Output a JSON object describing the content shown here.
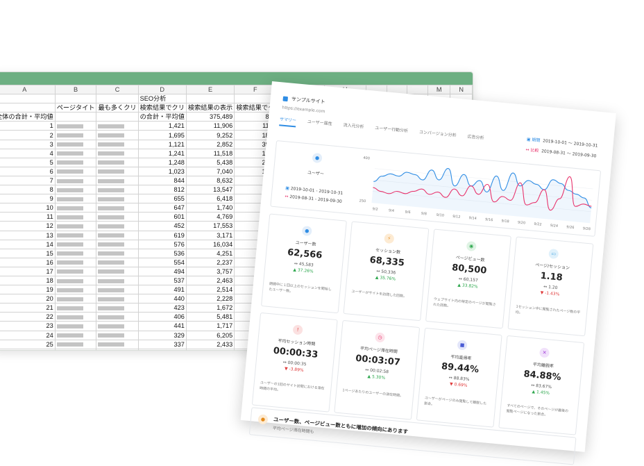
{
  "spreadsheet": {
    "columns": [
      "A",
      "B",
      "C",
      "D",
      "E",
      "F",
      "G",
      "H",
      "",
      "",
      "",
      "M",
      "N"
    ],
    "group_row": [
      "",
      "",
      "",
      "SEO分析",
      "",
      "",
      "",
      "サイト分析"
    ],
    "header_row": [
      "",
      "ページタイト",
      "最も多くクリ",
      "検索結果でクリ",
      "検索結果の表示",
      "検索結果でク",
      "検索結果の平均",
      "セッション数"
    ],
    "total_row": [
      "全体の合計・平均値",
      "",
      "",
      "の合計・平均値",
      "375,489",
      "8.1",
      "15.1",
      "48,947"
    ],
    "rows": [
      [
        "1",
        "1,421",
        "11,906",
        "11.9",
        "7.4",
        "2,489"
      ],
      [
        "2",
        "1,695",
        "9,252",
        "18.3",
        "7.8",
        "2,335"
      ],
      [
        "3",
        "1,121",
        "2,852",
        "39.3",
        "11.7",
        "1,996"
      ],
      [
        "4",
        "1,241",
        "11,518",
        "10.8",
        "5.7",
        "1,947"
      ],
      [
        "5",
        "1,248",
        "5,438",
        "22.9",
        "7.5",
        "1,858"
      ],
      [
        "6",
        "1,023",
        "7,040",
        "14.3",
        "9",
        "1,66"
      ],
      [
        "7",
        "844",
        "8,632",
        "9.8",
        "7.3",
        "1,32"
      ],
      [
        "8",
        "812",
        "13,547",
        "6",
        "7.1",
        "1,1"
      ],
      [
        "9",
        "655",
        "6,418",
        "10.2",
        "7.7",
        "1,0"
      ],
      [
        "10",
        "647",
        "1,740",
        "37.2",
        "9",
        "9"
      ],
      [
        "11",
        "601",
        "4,769",
        "12.6",
        "6",
        "9"
      ],
      [
        "12",
        "452",
        "17,553",
        "2.6",
        "8",
        "8"
      ],
      [
        "13",
        "619",
        "3,171",
        "19.5",
        "31.3",
        "8"
      ],
      [
        "14",
        "576",
        "16,034",
        "3.6",
        "7.8",
        ""
      ],
      [
        "15",
        "536",
        "4,251",
        "12.6",
        "6.5",
        ""
      ],
      [
        "16",
        "554",
        "2,237",
        "24.8",
        "5.2",
        ""
      ],
      [
        "17",
        "494",
        "3,757",
        "13.1",
        "17.6",
        ""
      ],
      [
        "18",
        "537",
        "2,463",
        "21.8",
        "7.5",
        ""
      ],
      [
        "19",
        "491",
        "2,514",
        "19.5",
        "4.5",
        ""
      ],
      [
        "20",
        "440",
        "2,228",
        "19.7",
        "4.4",
        ""
      ],
      [
        "21",
        "423",
        "1,672",
        "25.3",
        "11.5",
        ""
      ],
      [
        "22",
        "406",
        "5,481",
        "7.4",
        "11.6",
        ""
      ],
      [
        "23",
        "441",
        "1,717",
        "25.7",
        "20.9",
        ""
      ],
      [
        "24",
        "329",
        "6,205",
        "5.3",
        "11",
        ""
      ],
      [
        "25",
        "337",
        "2,433",
        "13.9",
        "25.2",
        ""
      ],
      [
        "26",
        "255",
        "8,591",
        "3",
        "9.8",
        ""
      ],
      [
        "27",
        "274",
        "4,258",
        "6.4",
        "7.3",
        ""
      ]
    ]
  },
  "dashboard": {
    "site_name": "サンプルサイト",
    "site_url": "https://example.com",
    "tabs": [
      "サマリー",
      "ユーザー属性",
      "流入元分析",
      "ユーザー行動分析",
      "コンバージョン分析",
      "広告分析"
    ],
    "period_label": "期間",
    "period_value": "2019-10-01 〜 2019-10-31",
    "compare_label": "比較",
    "compare_value": "2019-08-31 〜 2019-09-30",
    "users_label": "ユーザー",
    "users_period": "2019-10-01 - 2019-10-31",
    "users_compare": "2019-08-31 - 2019-09-30",
    "colors": {
      "primary": "#2f8de4",
      "compare": "#e8336c",
      "up": "#2fa84f",
      "down": "#e03c3c"
    },
    "chart_data": {
      "type": "line",
      "x": [
        "9/2",
        "9/4",
        "9/6",
        "9/8",
        "9/10",
        "9/12",
        "9/14",
        "9/16",
        "9/18",
        "9/20",
        "9/22",
        "9/24",
        "9/26",
        "9/28"
      ],
      "ylim": [
        250,
        400
      ],
      "y_ticks": [
        "400",
        "250"
      ],
      "series": [
        {
          "values": [
            320,
            340,
            350,
            345,
            360,
            355,
            340,
            375,
            345,
            385,
            330,
            370,
            335,
            355,
            320,
            375,
            330,
            390,
            350,
            370,
            360,
            345,
            380,
            370,
            350,
            340,
            330,
            300
          ]
        },
        {
          "values": [
            300,
            290,
            285,
            295,
            290,
            300,
            310,
            295,
            305,
            290,
            320,
            300,
            335,
            310,
            345,
            290,
            310,
            300,
            360,
            290,
            300,
            345,
            280,
            320,
            395,
            300,
            310,
            305
          ]
        }
      ]
    },
    "kpis": [
      {
        "icon": "user-icon",
        "title": "ユーザー数",
        "value": "62,566",
        "compare": "↔ 45,583",
        "change": "▲ 37.26%",
        "dir": "up",
        "desc": "期間中に１回以上のセッションを開始したユーザー数。",
        "color": "#2f8de4",
        "bg": "#e3eefa",
        "glyph": "●"
      },
      {
        "icon": "bolt-icon",
        "title": "セッション数",
        "value": "68,335",
        "compare": "↔ 50,336",
        "change": "▲ 35.76%",
        "dir": "up",
        "desc": "ユーザーがサイトを訪問した回数。",
        "color": "#e48a1a",
        "bg": "#fdebd3",
        "glyph": "⚡"
      },
      {
        "icon": "eye-icon",
        "title": "ページビュー数",
        "value": "80,500",
        "compare": "↔ 60,157",
        "change": "▲ 33.82%",
        "dir": "up",
        "desc": "ウェブサイト内の特定のページが閲覧された回数。",
        "color": "#2fa84f",
        "bg": "#dff3e4",
        "glyph": "◉"
      },
      {
        "icon": "monitor-icon",
        "title": "ページ/セッション",
        "value": "1.18",
        "compare": "↔ 1.20",
        "change": "▼ -1.43%",
        "dir": "down",
        "desc": "1セッション中に閲覧されたページ数の平均。",
        "color": "#3aa0e0",
        "bg": "#e0f1fb",
        "glyph": "▭"
      },
      {
        "icon": "alert-icon",
        "title": "平均セッション時間",
        "value": "00:00:33",
        "compare": "↔ 00:00:35",
        "change": "▼ -3.89%",
        "dir": "down",
        "desc": "ユーザーの1回のサイト訪問における滞在時間の平均。",
        "color": "#e03c3c",
        "bg": "#fbe1e1",
        "glyph": "!"
      },
      {
        "icon": "clock-icon",
        "title": "平均ページ滞在時間",
        "value": "00:03:07",
        "compare": "↔ 00:02:58",
        "change": "▲ 5.30%",
        "dir": "up",
        "desc": "1ページあたりのユーザーの滞在時間。",
        "color": "#e8336c",
        "bg": "#fce3ea",
        "glyph": "◷"
      },
      {
        "icon": "exit-icon",
        "title": "平均直帰率",
        "value": "89.44%",
        "compare": "↔ 88.83%",
        "change": "▼ 0.69%",
        "dir": "down",
        "desc": "ユーザーがページのみ閲覧して離脱した割合。",
        "color": "#4a5bd4",
        "bg": "#e3e6fa",
        "glyph": "■"
      },
      {
        "icon": "close-circle-icon",
        "title": "平均離脱率",
        "value": "84.88%",
        "compare": "↔ 83.67%",
        "change": "▲ 1.45%",
        "dir": "up",
        "desc": "すべてのページで、そのページが最後の閲覧ページになった割合。",
        "color": "#a43fd8",
        "bg": "#f1e1fb",
        "glyph": "✕"
      }
    ],
    "message_title": "ユーザー数、ページビュー数ともに増加の傾向にあります",
    "message_sub": "平均ページ滞在時間も"
  }
}
